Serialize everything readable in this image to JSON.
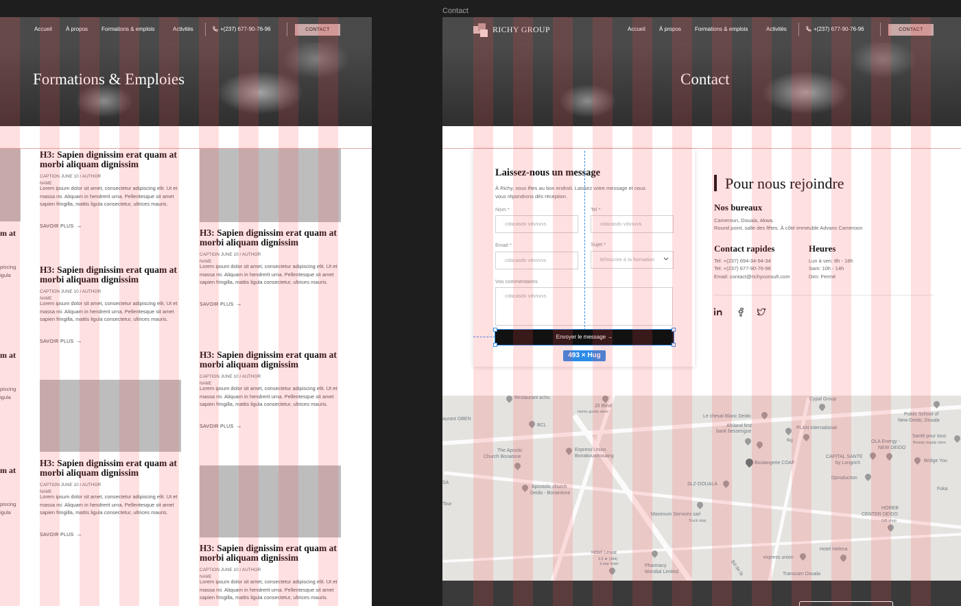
{
  "frame_label": "Contact",
  "nav": {
    "logo": "RICHY GROUP",
    "links": [
      "Accueil",
      "À propos",
      "Formations & emplois",
      "Activités"
    ],
    "phone": "+(237) 677-90-76-96",
    "cta": "CONTACT"
  },
  "left_page": {
    "hero_title": "Formations & Emploies",
    "card": {
      "title_line1": "H3: Sapien dignissim erat quam at",
      "title_line2": "morbi aliquam dignissim",
      "caption": "CAPTION JUNE 10 / AUTHOR",
      "name": "NAME",
      "body": "Lorem ipsum dolor sit amet, consectetur adipiscing elit. Ut et massa mi. Aliquam in hendrerit urna. Pellentesque sit amet sapien fringilla, mattis ligula consectetur, ultrices mauris.",
      "more": "SAVOIR PLUS"
    },
    "ghost_text": [
      "m at",
      "piscing",
      "igula"
    ]
  },
  "right_page": {
    "hero_title": "Contact",
    "form": {
      "title": "Laissez-nous un message",
      "intro": "À Richy, vous êtes au bon endroit. Laissez votre message et nous vous répondrons dès réception.",
      "fields": {
        "nom_label": "Nom *",
        "tel_label": "Tel *",
        "email_label": "Email *",
        "sujet_label": "Sujet *",
        "comments_label": "Vos commentaires",
        "nom_value": "cdacasdv vdvsvvs",
        "tel_value": "cdacasdv vdvsvvs",
        "email_value": "cdacasdv vdvsvvs",
        "sujet_value": "M'inscrire à la formation",
        "comments_value": "cdacasdv vdvsvvs"
      },
      "submit": "Envoyer le message",
      "size_badge": "493 × Hug"
    },
    "join": {
      "title": "Pour nous rejoindre",
      "offices_heading": "Nos bureaux",
      "offices_line1": "Cameroun, Douala, Akwa.",
      "offices_line2": "Round point, salle des fêtes. À côté immeuble Advans Cameroon",
      "quick_heading": "Contact rapides",
      "quick_lines": [
        "Tel: +(237) 694-34-94-34",
        "Tel: +(237) 677-90-76-96",
        "Email: contact@richyconsult.com"
      ],
      "hours_heading": "Heures",
      "hours_lines": [
        "Lun à ven: 8h - 18h",
        "Sam: 10h - 14h",
        "Dim: Fermé"
      ],
      "socials": [
        "linkedin-icon",
        "facebook-icon",
        "twitter-icon"
      ]
    },
    "map_labels": {
      "l1": "Restaurant achu",
      "l2": "Zil Blind",
      "l3": "Home goods store",
      "l4": "Cypal Group",
      "l5": "Public School of",
      "l6": "New-Deido, Douala",
      "l7": "aurant OBEN",
      "l8": "BCL",
      "l9": "Le cheval Blanc Deido",
      "l10": "Afriland first",
      "l11": "bank bessengue",
      "l12": "PLAN International",
      "l13": "Santé pour tous",
      "l14": "The Apostic",
      "l15": "Church Bonatone",
      "l16": "Express Union",
      "l17": "Bonakouamouang",
      "l18": "OLA Energy -",
      "l19": "NEW DEIDO",
      "l20": "Boulangerie COAF",
      "l21": "CAPITAL SANTE",
      "l22": "by Longrich",
      "l23": "Bridge You",
      "l24": "Dproduction",
      "l25": "Apostolic church",
      "l26": "Deido - Bonantone",
      "l27": "SLZ-DOUALA",
      "l28": "SA",
      "l29": "Tour",
      "l30": "Maximum Services sarl",
      "l31": "HOREB",
      "l32": "CENTER DEIDO",
      "l33": "Hôtel Lewat",
      "l34": "Pharmacy",
      "l35": "Mondial Limited",
      "l36": "express union",
      "l37": "Hotel Helena",
      "l38": "Transcam Douala",
      "l39": "Bd de la",
      "l40": "Foka",
      "l41": "Beauty supply store",
      "l42": "3.5 ★ (344)",
      "l43": "3-star hotel",
      "l44": "Gift shop",
      "l45": "Truck stop",
      "l46": "Big"
    }
  },
  "colors": {
    "column_overlay": "#ff4650",
    "selection_blue": "#2d8be8",
    "nav_bg": "#4a4a4a",
    "cta_bg": "#c9a9a7"
  }
}
